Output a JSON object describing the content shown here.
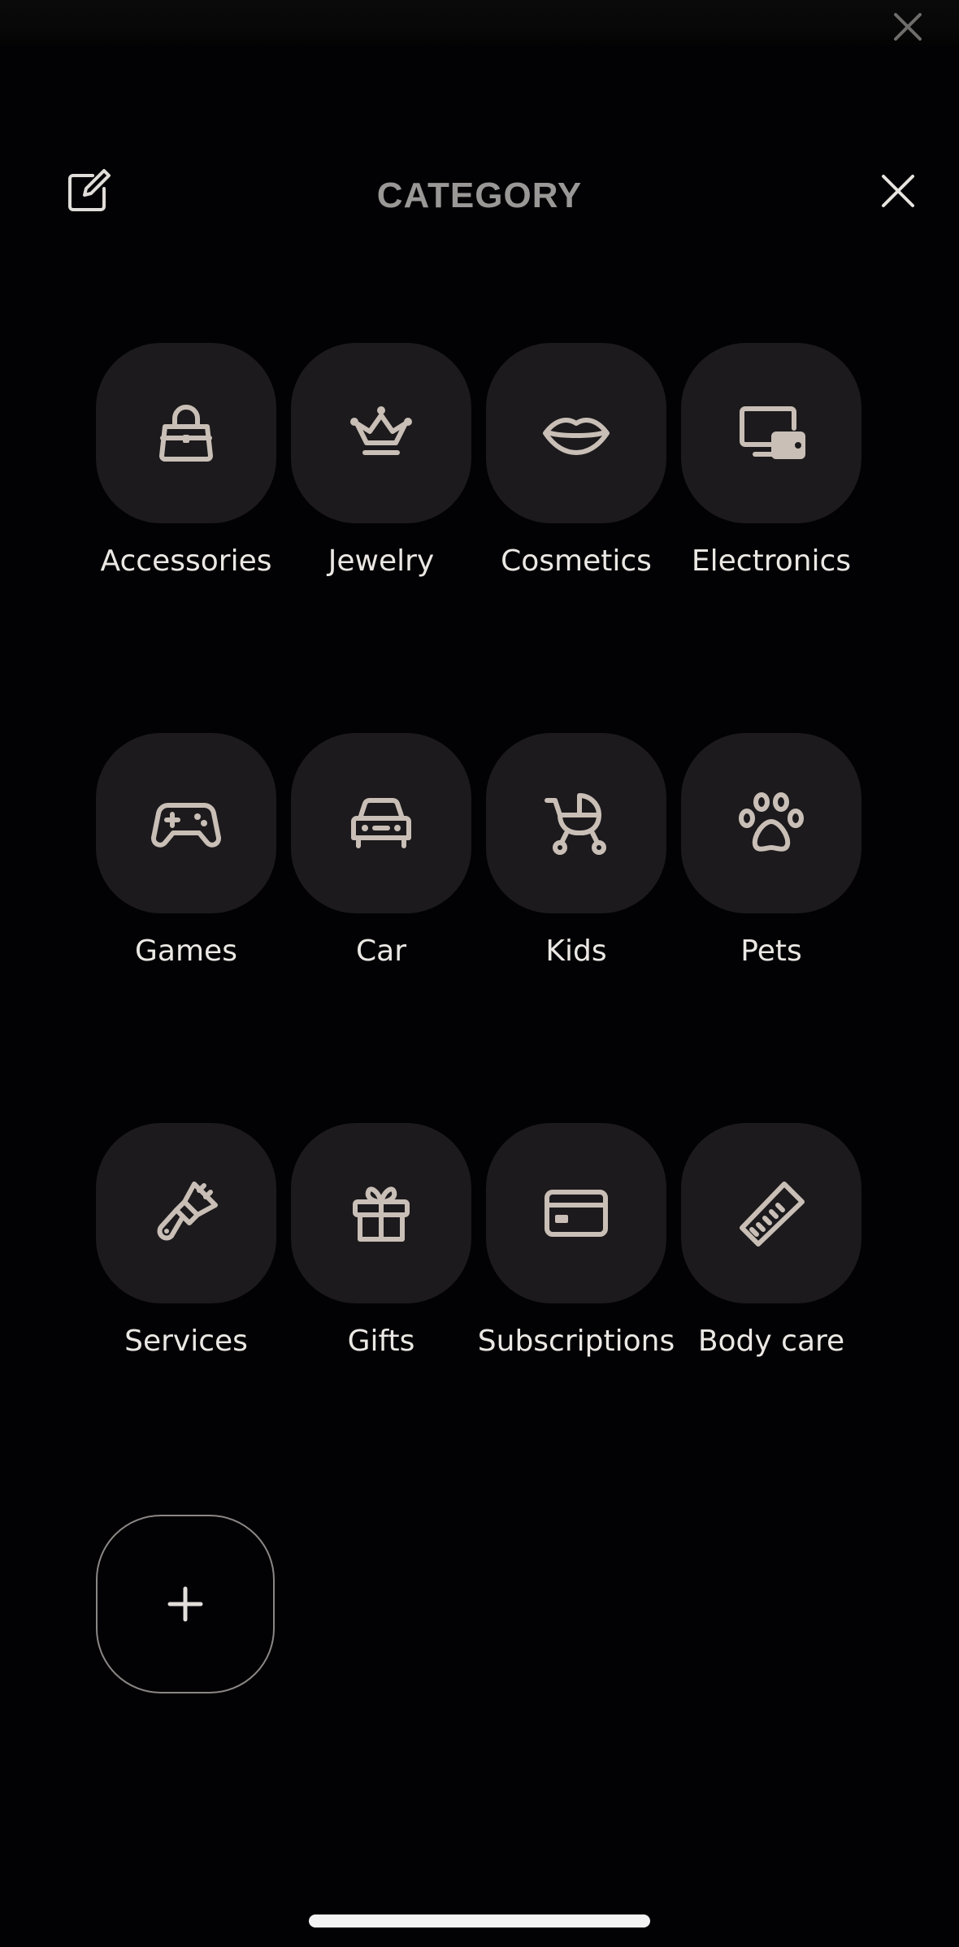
{
  "header": {
    "title": "CATEGORY"
  },
  "categories": [
    {
      "label": "Accessories",
      "icon": "handbag-icon"
    },
    {
      "label": "Jewelry",
      "icon": "crown-icon"
    },
    {
      "label": "Cosmetics",
      "icon": "lips-icon"
    },
    {
      "label": "Electronics",
      "icon": "devices-icon"
    },
    {
      "label": "Games",
      "icon": "gamepad-icon"
    },
    {
      "label": "Car",
      "icon": "car-icon"
    },
    {
      "label": "Kids",
      "icon": "stroller-icon"
    },
    {
      "label": "Pets",
      "icon": "paw-icon"
    },
    {
      "label": "Services",
      "icon": "paintbrush-icon"
    },
    {
      "label": "Gifts",
      "icon": "gift-icon"
    },
    {
      "label": "Subscriptions",
      "icon": "credit-card-icon"
    },
    {
      "label": "Body care",
      "icon": "comb-icon"
    }
  ],
  "colors": {
    "background": "#020104",
    "tile": "#1c1a1c",
    "icon": "#c9bfb7",
    "label": "#ebe8e4",
    "title": "#9a9896"
  }
}
